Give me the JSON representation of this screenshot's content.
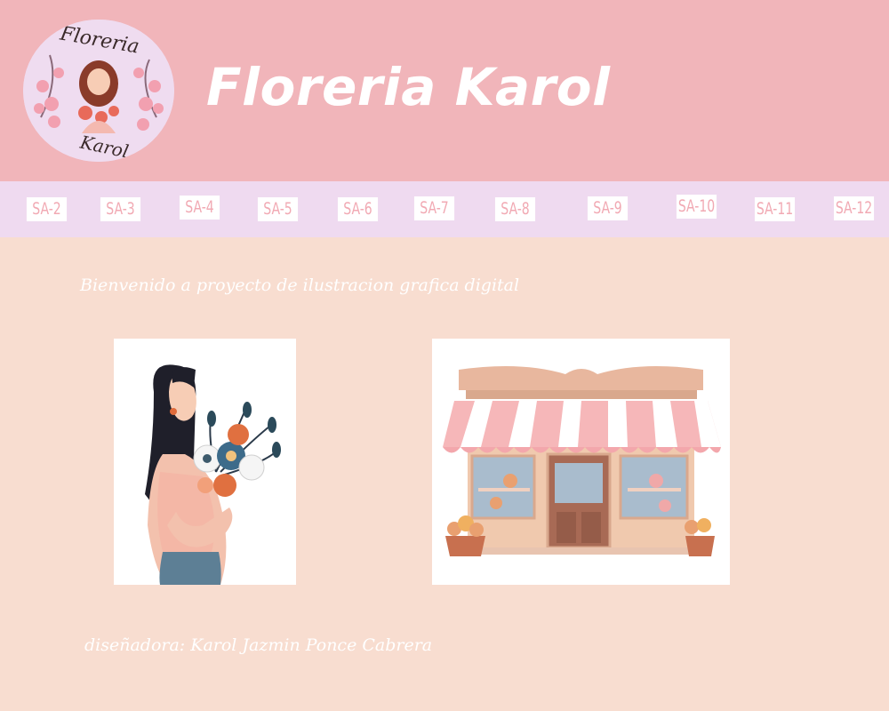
{
  "header": {
    "logo_text_top": "Floreria",
    "logo_text_bottom": "Karol",
    "title": "Floreria Karol"
  },
  "nav": {
    "items": [
      "SA-2",
      "SA-3",
      "SA-4",
      "SA-5",
      "SA-6",
      "SA-7",
      "SA-8",
      "SA-9",
      "SA-10",
      "SA-11",
      "SA-12"
    ]
  },
  "main": {
    "welcome": "Bienvenido a proyecto de ilustracion grafica digital",
    "designer": "diseñadora: Karol Jazmin Ponce Cabrera"
  },
  "colors": {
    "header_bg": "#f1b5ba",
    "nav_bg": "#efdaf0",
    "page_bg": "#f8ddd0",
    "nav_text": "#f1a9b3"
  }
}
